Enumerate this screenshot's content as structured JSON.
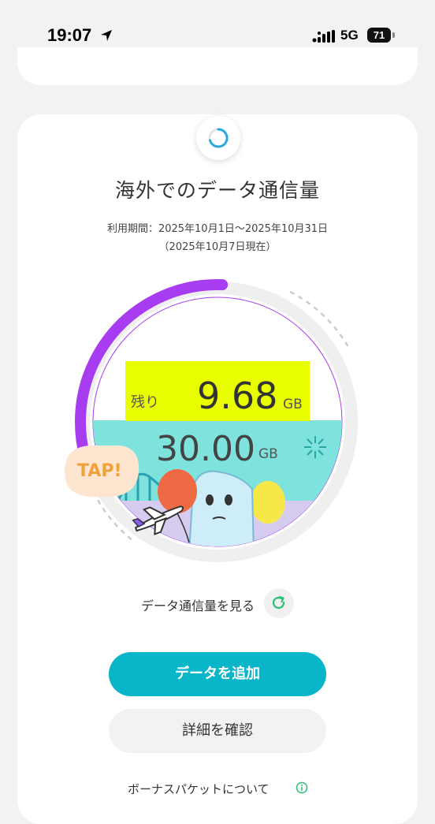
{
  "status_bar": {
    "time": "19:07",
    "network": "5G",
    "battery": "71"
  },
  "card": {
    "title": "海外でのデータ通信量",
    "period": "利用期間：2025年10月1日〜2025年10月31日",
    "as_of": "（2025年10月7日現在）"
  },
  "gauge": {
    "remaining_label": "残り",
    "remaining_value": "9.68",
    "remaining_unit": "GB",
    "total_value": "30.00",
    "total_unit": "GB",
    "tap_label": "TAP!",
    "used_fraction": 0.677,
    "colors": {
      "progress": "#a83cf0",
      "remaining_highlight": "#e9ff00",
      "total_band": "#7ee3dc"
    }
  },
  "actions": {
    "view_usage_label": "データ通信量を見る",
    "add_data_label": "データを追加",
    "details_label": "詳細を確認",
    "bonus_label": "ボーナスパケットについて"
  },
  "accent_color": "#08b5c9"
}
